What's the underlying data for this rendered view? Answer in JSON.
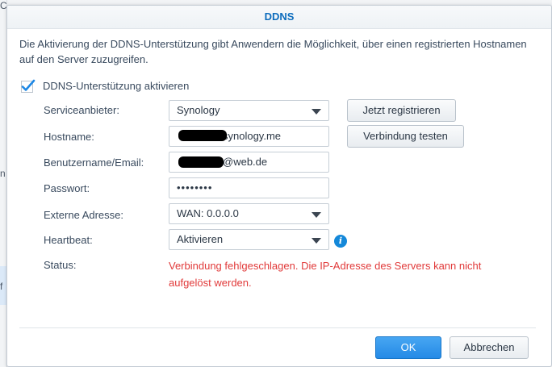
{
  "dialog": {
    "title": "DDNS",
    "intro": "Die Aktivierung der DDNS-Unterstützung gibt Anwendern die Möglichkeit, über einen registrierten Hostnamen auf den Server zuzugreifen.",
    "enable_label": "DDNS-Unterstützung aktivieren",
    "enable_checked": true
  },
  "form": {
    "provider_label": "Serviceanbieter:",
    "provider_value": "Synology",
    "hostname_label": "Hostname:",
    "hostname_value": "synology.me",
    "username_label": "Benutzername/Email:",
    "username_value": "@web.de",
    "password_label": "Passwort:",
    "password_value": "••••••••",
    "external_label": "Externe Adresse:",
    "external_value": "WAN: 0.0.0.0",
    "heartbeat_label": "Heartbeat:",
    "heartbeat_value": "Aktivieren",
    "status_label": "Status:",
    "status_value": "Verbindung fehlgeschlagen. Die IP-Adresse des Servers kann nicht aufgelöst werden."
  },
  "buttons": {
    "register": "Jetzt registrieren",
    "test": "Verbindung testen",
    "ok": "OK",
    "cancel": "Abbrechen"
  },
  "background": {
    "mark_top": "C",
    "mark_mid": "n",
    "mark_low": "f"
  },
  "colors": {
    "accent": "#0c6cbd",
    "checkbox": "#1e88e5",
    "error": "#e13a3a",
    "primary_button": "#258ae6"
  },
  "icons": {
    "check": "check-icon",
    "dropdown": "chevron-down-icon",
    "info": "info-icon"
  }
}
